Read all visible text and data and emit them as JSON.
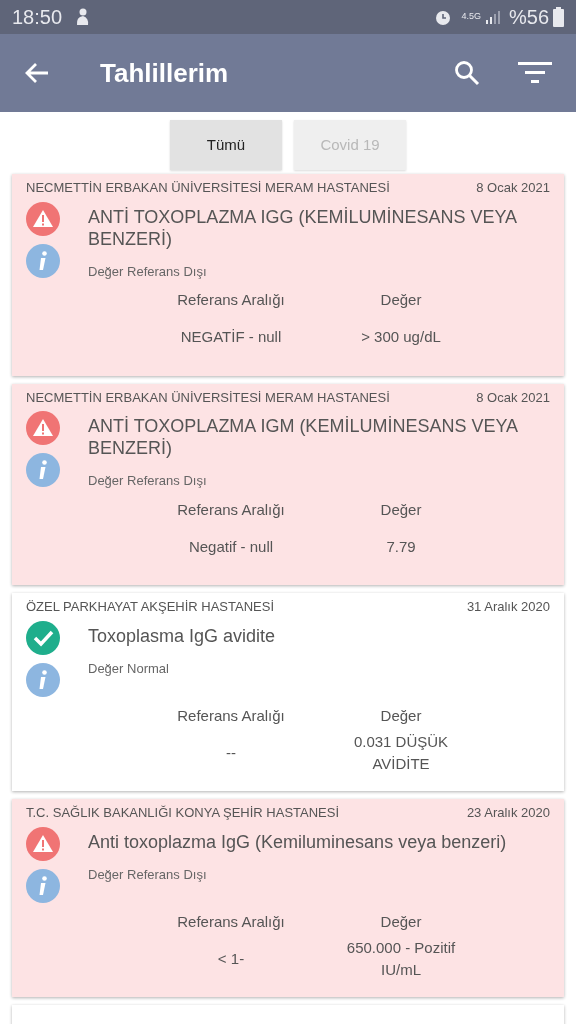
{
  "status_bar": {
    "time": "18:50",
    "network": "4.5G",
    "battery": "%56"
  },
  "app_bar": {
    "title": "Tahlillerim"
  },
  "tabs": [
    {
      "label": "Tümü",
      "selected": true
    },
    {
      "label": "Covid 19",
      "selected": false
    }
  ],
  "results": [
    {
      "hospital": "NECMETTİN ERBAKAN ÜNİVERSİTESİ MERAM HASTANESİ",
      "date": "8 Ocak 2021",
      "kind": "abnormal",
      "test": "ANTİ TOXOPLAZMA IGG (KEMİLUMİNESANS VEYA BENZERİ)",
      "status": "Değer Referans Dışı",
      "range_label": "Referans Aralığı",
      "value_label": "Değer",
      "range": "NEGATİF - null",
      "value": "> 300 ug/dL"
    },
    {
      "hospital": "NECMETTİN ERBAKAN ÜNİVERSİTESİ MERAM HASTANESİ",
      "date": "8 Ocak 2021",
      "kind": "abnormal",
      "test": "ANTİ TOXOPLAZMA IGM (KEMİLUMİNESANS VEYA BENZERİ)",
      "status": "Değer Referans Dışı",
      "range_label": "Referans Aralığı",
      "value_label": "Değer",
      "range": "Negatif - null",
      "value": "7.79"
    },
    {
      "hospital": "ÖZEL PARKHAYAT AKŞEHİR HASTANESİ",
      "date": "31 Aralık 2020",
      "kind": "normal",
      "test": "Toxoplasma IgG avidite",
      "status": "Değer Normal",
      "range_label": "Referans Aralığı",
      "value_label": "Değer",
      "range": "--",
      "value": "0.031 DÜŞÜK AVİDİTE"
    },
    {
      "hospital": "T.C. SAĞLIK BAKANLIĞI KONYA ŞEHİR HASTANESİ",
      "date": "23 Aralık 2020",
      "kind": "abnormal",
      "test": "Anti toxoplazma IgG (Kemiluminesans veya benzeri)",
      "status": "Değer Referans Dışı",
      "range_label": "Referans Aralığı",
      "value_label": "Değer",
      "range": "< 1-",
      "value": "650.000 - Pozitif IU/mL"
    }
  ]
}
